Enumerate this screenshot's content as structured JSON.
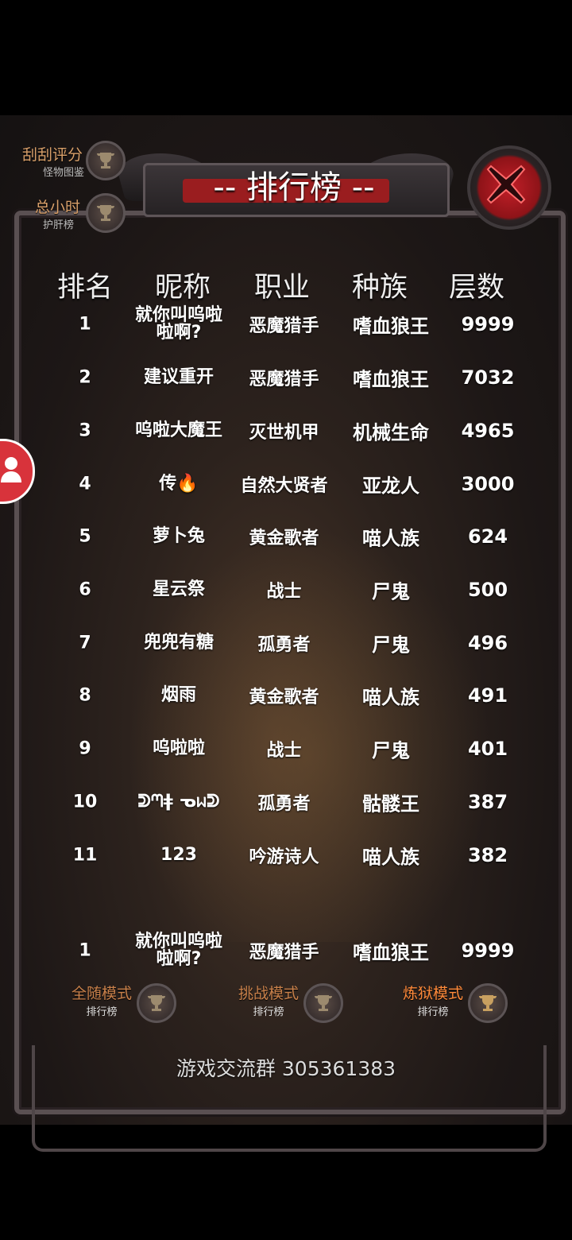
{
  "title": "-- 排行榜 --",
  "side_buttons": [
    {
      "label": "刮刮评分",
      "sub": "怪物图鉴"
    },
    {
      "label": "总小时",
      "sub": "护肝榜"
    }
  ],
  "headers": [
    "排名",
    "昵称",
    "职业",
    "种族",
    "层数"
  ],
  "rows": [
    {
      "rank": "1",
      "name": "就你叫呜啦啦啊?",
      "class": "恶魔猎手",
      "race": "嗜血狼王",
      "floor": "9999"
    },
    {
      "rank": "2",
      "name": "建议重开",
      "class": "恶魔猎手",
      "race": "嗜血狼王",
      "floor": "7032"
    },
    {
      "rank": "3",
      "name": "呜啦大魔王",
      "class": "灭世机甲",
      "race": "机械生命",
      "floor": "4965"
    },
    {
      "rank": "4",
      "name": "传",
      "class": "自然大贤者",
      "race": "亚龙人",
      "floor": "3000"
    },
    {
      "rank": "5",
      "name": "萝卜兔",
      "class": "黄金歌者",
      "race": "喵人族",
      "floor": "624"
    },
    {
      "rank": "6",
      "name": "星云祭",
      "class": "战士",
      "race": "尸鬼",
      "floor": "500"
    },
    {
      "rank": "7",
      "name": "兜兜有糖",
      "class": "孤勇者",
      "race": "尸鬼",
      "floor": "496"
    },
    {
      "rank": "8",
      "name": "烟雨",
      "class": "黄金歌者",
      "race": "喵人族",
      "floor": "491"
    },
    {
      "rank": "9",
      "name": "呜啦啦",
      "class": "战士",
      "race": "尸鬼",
      "floor": "401"
    },
    {
      "rank": "10",
      "name": "ᕲᘉǂ ᓀᥕᕲ",
      "class": "孤勇者",
      "race": "骷髅王",
      "floor": "387"
    },
    {
      "rank": "11",
      "name": "123",
      "class": "吟游诗人",
      "race": "喵人族",
      "floor": "382"
    }
  ],
  "my_row": {
    "rank": "1",
    "name": "就你叫呜啦啦啊?",
    "class": "恶魔猎手",
    "race": "嗜血狼王",
    "floor": "9999"
  },
  "modes": [
    {
      "label": "全随模式",
      "sub": "排行榜",
      "color": "#c8804a"
    },
    {
      "label": "挑战模式",
      "sub": "排行榜",
      "color": "#c8804a"
    },
    {
      "label": "炼狱模式",
      "sub": "排行榜",
      "color": "#ff8a3a"
    }
  ],
  "footer": "游戏交流群 305361383",
  "icons": {
    "close": "close-x-icon",
    "trophy": "trophy-icon",
    "avatar": "user-icon",
    "flame": "fire-emoji"
  }
}
